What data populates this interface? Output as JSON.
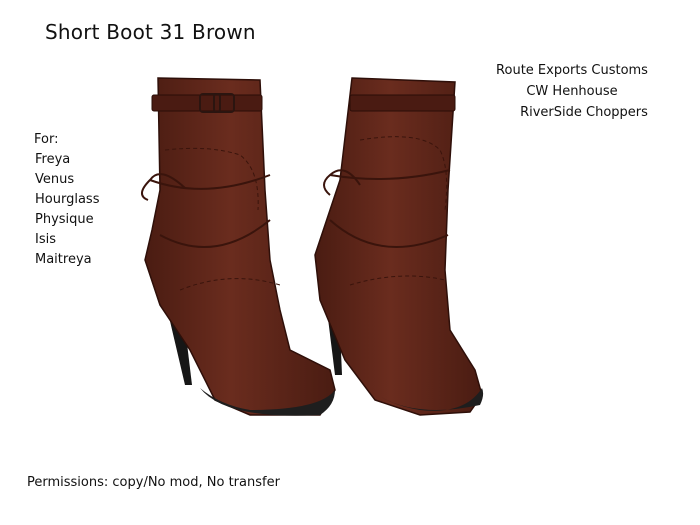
{
  "product": {
    "title": "Short Boot 31 Brown"
  },
  "brands": [
    "Route Exports Customs",
    "CW Henhouse",
    "RiverSide Choppers"
  ],
  "compatibility": {
    "label": "For:",
    "bodies": [
      "Freya",
      "Venus",
      "Hourglass",
      "Physique",
      "Isis",
      "Maitreya"
    ]
  },
  "permissions": "Permissions: copy/No mod, No transfer",
  "colors": {
    "leather": "#5a2418",
    "leather_dark": "#3e160e",
    "heel": "#1a1a1a"
  }
}
